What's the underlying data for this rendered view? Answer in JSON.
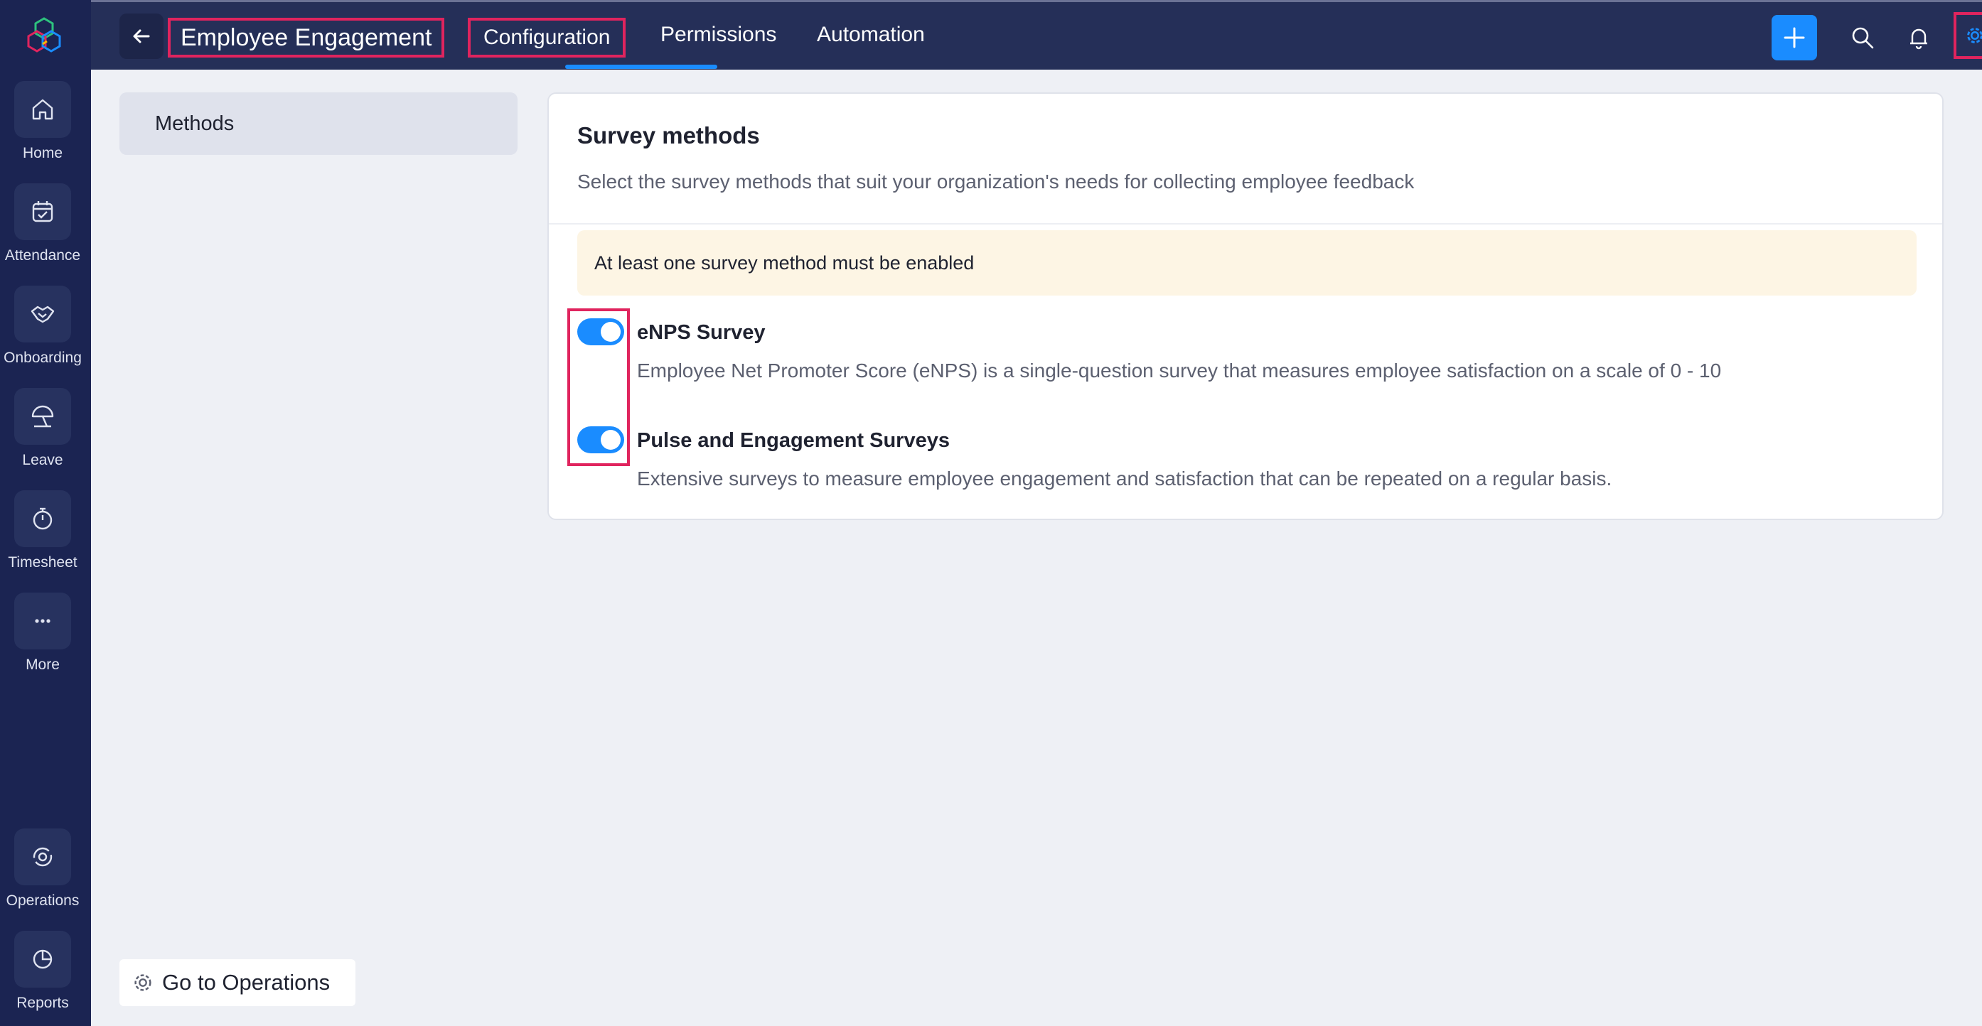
{
  "nav": {
    "items": [
      {
        "label": "Home",
        "icon": "home-icon"
      },
      {
        "label": "Attendance",
        "icon": "calendar-check-icon"
      },
      {
        "label": "Onboarding",
        "icon": "handshake-icon"
      },
      {
        "label": "Leave",
        "icon": "beach-umbrella-icon"
      },
      {
        "label": "Timesheet",
        "icon": "stopwatch-icon"
      },
      {
        "label": "More",
        "icon": "more-dots-icon"
      },
      {
        "label": "Operations",
        "icon": "operations-icon"
      },
      {
        "label": "Reports",
        "icon": "pie-chart-icon"
      }
    ]
  },
  "header": {
    "title": "Employee Engagement",
    "tabs": [
      {
        "label": "Configuration",
        "active": true
      },
      {
        "label": "Permissions",
        "active": false
      },
      {
        "label": "Automation",
        "active": false
      }
    ]
  },
  "sidebar": {
    "items": [
      {
        "label": "Methods",
        "selected": true
      }
    ]
  },
  "main": {
    "title": "Survey methods",
    "subtitle": "Select the survey methods that suit your organization's needs for collecting employee feedback",
    "notice": "At least one survey method must be enabled",
    "methods": [
      {
        "title": "eNPS Survey",
        "description": "Employee Net Promoter Score (eNPS) is a single-question survey that measures employee satisfaction on a scale of 0 - 10",
        "enabled": true
      },
      {
        "title": "Pulse and Engagement Surveys",
        "description": "Extensive surveys to measure employee engagement and satisfaction that can be repeated on a regular basis.",
        "enabled": true
      }
    ]
  },
  "footer": {
    "go_operations": "Go to Operations"
  },
  "colors": {
    "rail": "#1b2452",
    "topbar": "#252f58",
    "accent": "#1a8cff",
    "highlight": "#e0245e",
    "notice_bg": "#fdf5e4"
  }
}
